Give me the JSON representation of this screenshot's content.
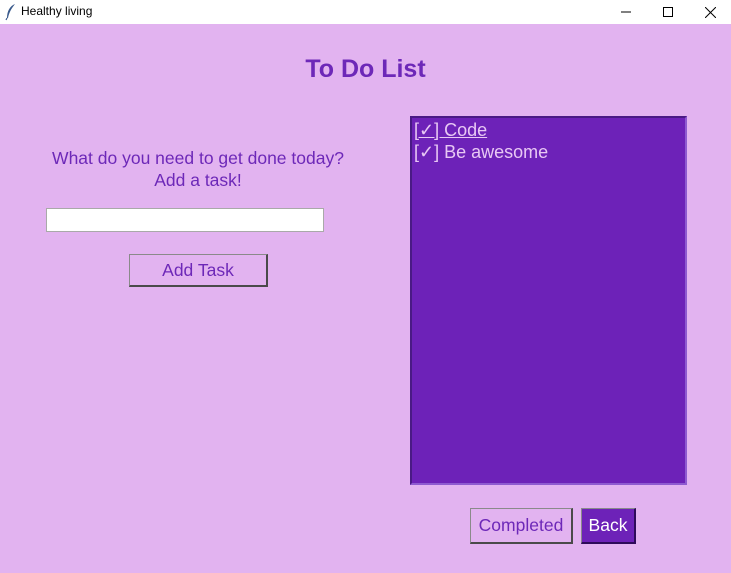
{
  "window": {
    "title": "Healthy living",
    "app_icon": "feather-icon",
    "controls": [
      "minimize-icon",
      "maximize-icon",
      "close-icon"
    ]
  },
  "page": {
    "title": "To Do List",
    "prompt_line1": "What do you need to get done today?",
    "prompt_line2": "Add a task!"
  },
  "task_input": {
    "value": "",
    "placeholder": ""
  },
  "buttons": {
    "add_task": "Add Task",
    "completed": "Completed",
    "back": "Back"
  },
  "tasks": [
    {
      "label": "[✓] Code",
      "active": true
    },
    {
      "label": "[✓] Be awesome",
      "active": false
    }
  ],
  "colors": {
    "background": "#e2b3f0",
    "accent": "#6d28b8",
    "list_background": "#6d22b8",
    "list_text": "#e8c8f4"
  }
}
